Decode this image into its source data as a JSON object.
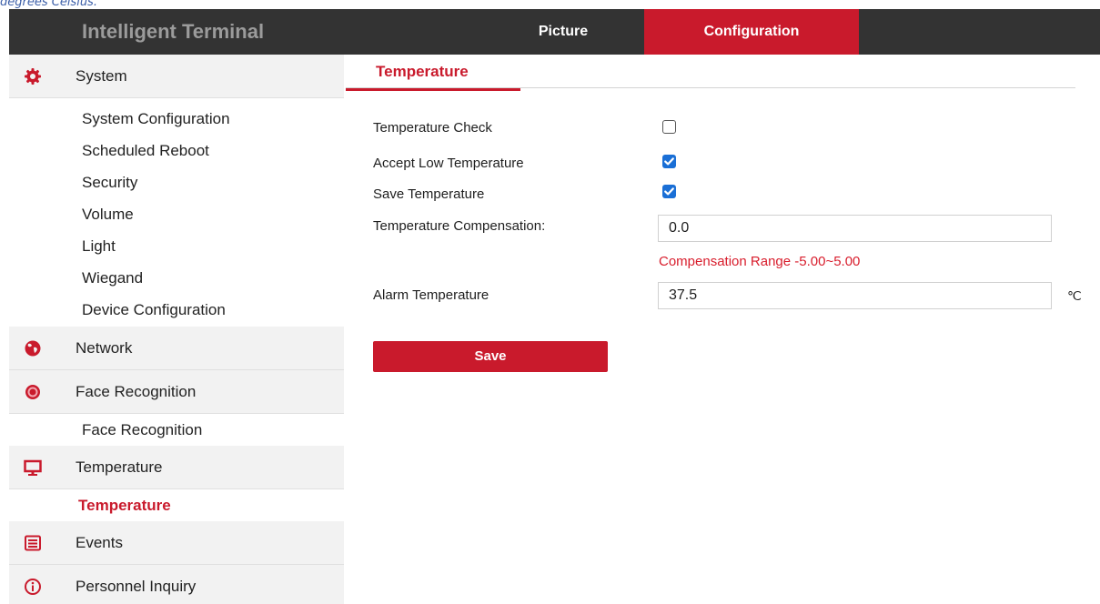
{
  "caption": "degrees Celsius.",
  "header": {
    "brand": "Intelligent Terminal",
    "tabs": [
      {
        "label": "Picture",
        "active": false
      },
      {
        "label": "Configuration",
        "active": true
      }
    ]
  },
  "sidebar": {
    "sections": [
      {
        "label": "System",
        "icon": "gear-icon",
        "items": [
          "System Configuration",
          "Scheduled Reboot",
          "Security",
          "Volume",
          "Light",
          "Wiegand",
          "Device Configuration"
        ]
      },
      {
        "label": "Network",
        "icon": "globe-icon",
        "items": []
      },
      {
        "label": "Face Recognition",
        "icon": "target-icon",
        "items": [
          "Face Recognition"
        ]
      },
      {
        "label": "Temperature",
        "icon": "monitor-icon",
        "items": [
          "Temperature"
        ],
        "active_item": "Temperature"
      },
      {
        "label": "Events",
        "icon": "list-icon",
        "items": []
      },
      {
        "label": "Personnel Inquiry",
        "icon": "info-icon",
        "items": []
      }
    ]
  },
  "main": {
    "tab": "Temperature",
    "fields": {
      "temperature_check": {
        "label": "Temperature Check",
        "checked": false
      },
      "accept_low": {
        "label": "Accept Low Temperature",
        "checked": true
      },
      "save_temperature": {
        "label": "Save Temperature",
        "checked": true
      },
      "compensation": {
        "label": "Temperature Compensation:",
        "value": "0.0",
        "hint": "Compensation Range -5.00~5.00"
      },
      "alarm": {
        "label": "Alarm Temperature",
        "value": "37.5",
        "unit": "℃"
      }
    },
    "save_label": "Save"
  },
  "colors": {
    "accent": "#c91a2c",
    "header_bg": "#333333",
    "checkbox_on": "#1a6fd6",
    "hint": "#d81d2c"
  }
}
